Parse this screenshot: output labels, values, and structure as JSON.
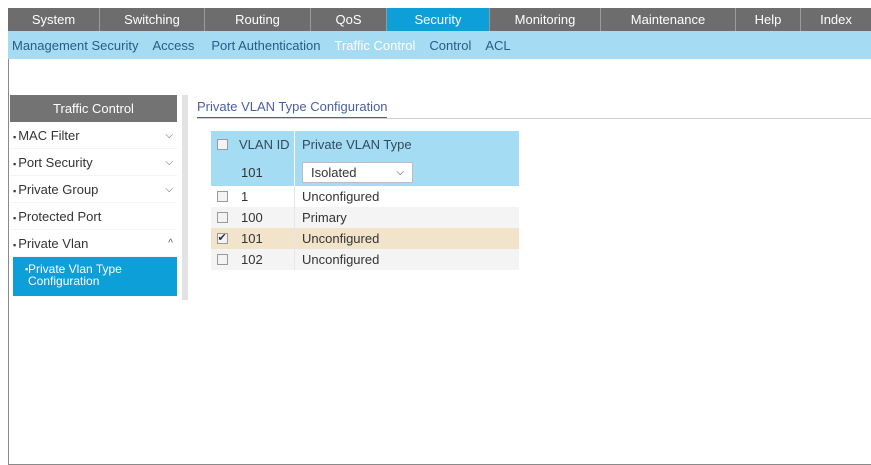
{
  "topnav": {
    "tabs": [
      {
        "label": "System",
        "active": false
      },
      {
        "label": "Switching",
        "active": false
      },
      {
        "label": "Routing",
        "active": false
      },
      {
        "label": "QoS",
        "active": false
      },
      {
        "label": "Security",
        "active": true
      },
      {
        "label": "Monitoring",
        "active": false
      },
      {
        "label": "Maintenance",
        "active": false
      },
      {
        "label": "Help",
        "active": false
      },
      {
        "label": "Index",
        "active": false
      }
    ]
  },
  "subnav": {
    "items": [
      {
        "label": "Management Security",
        "active": false
      },
      {
        "label": "Access",
        "active": false
      },
      {
        "label": "Port Authentication",
        "active": false
      },
      {
        "label": "Traffic Control",
        "active": true
      },
      {
        "label": "Control",
        "active": false
      },
      {
        "label": "ACL",
        "active": false
      }
    ]
  },
  "sidebar": {
    "header": "Traffic Control",
    "items": [
      {
        "label": "MAC Filter",
        "chevron": "chevron-down-icon"
      },
      {
        "label": "Port Security",
        "chevron": "chevron-down-icon"
      },
      {
        "label": "Private Group",
        "chevron": "chevron-down-icon"
      },
      {
        "label": "Protected Port",
        "chevron": ""
      },
      {
        "label": "Private Vlan",
        "chevron": "chevron-up-icon"
      }
    ],
    "active_sub": {
      "line1": "Private Vlan Type",
      "line2": "Configuration"
    }
  },
  "content": {
    "title": "Private VLAN Type Configuration",
    "table": {
      "headers": {
        "vlan_id": "VLAN ID",
        "type": "Private VLAN Type"
      },
      "edit_row": {
        "vlan_id": "101",
        "type_selected": "Isolated"
      },
      "rows": [
        {
          "vlan_id": "1",
          "type": "Unconfigured",
          "checked": false
        },
        {
          "vlan_id": "100",
          "type": "Primary",
          "checked": false
        },
        {
          "vlan_id": "101",
          "type": "Unconfigured",
          "checked": true
        },
        {
          "vlan_id": "102",
          "type": "Unconfigured",
          "checked": false
        }
      ]
    }
  },
  "colors": {
    "nav_bg": "#6d6d6d",
    "accent": "#0d9fd8",
    "subnav_bg": "#a5dcf4",
    "selected_row": "#f1e4cb"
  }
}
